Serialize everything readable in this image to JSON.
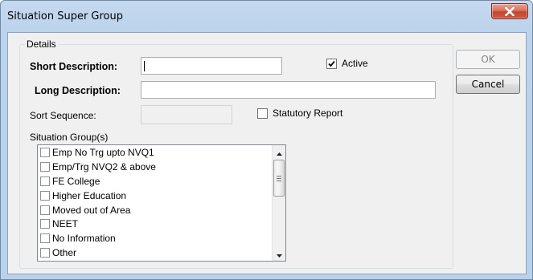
{
  "window": {
    "title": "Situation Super Group"
  },
  "details": {
    "group_label": "Details",
    "short_description_label": "Short Description:",
    "short_description_value": "",
    "long_description_label": "Long Description:",
    "long_description_value": "",
    "sort_sequence_label": "Sort Sequence:",
    "sort_sequence_value": "",
    "active": {
      "label": "Active",
      "checked": true
    },
    "statutory_report": {
      "label": "Statutory Report",
      "checked": false
    },
    "situation_groups_label": "Situation Group(s)",
    "situation_groups": [
      {
        "label": "Emp No Trg upto NVQ1",
        "checked": false
      },
      {
        "label": "Emp/Trg NVQ2 & above",
        "checked": false
      },
      {
        "label": "FE College",
        "checked": false
      },
      {
        "label": "Higher Education",
        "checked": false
      },
      {
        "label": "Moved out of Area",
        "checked": false
      },
      {
        "label": "NEET",
        "checked": false
      },
      {
        "label": "No Information",
        "checked": false
      },
      {
        "label": "Other",
        "checked": false
      }
    ]
  },
  "buttons": {
    "ok_label": "OK",
    "cancel_label": "Cancel"
  },
  "icons": {
    "close": "close-icon",
    "checkmark": "checkmark-icon",
    "scroll_up": "scroll-up-arrow-icon",
    "scroll_down": "scroll-down-arrow-icon"
  },
  "colors": {
    "close_button": "#c4452f",
    "title_bar": "#c5d9ef",
    "client_background": "#f0f0f0"
  }
}
